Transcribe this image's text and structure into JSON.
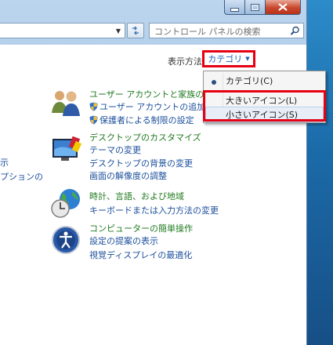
{
  "search": {
    "placeholder": "コントロール パネルの検索"
  },
  "view": {
    "label": "表示方法",
    "current": "カテゴリ"
  },
  "menu": {
    "items": [
      "カテゴリ(C)",
      "大きいアイコン(L)",
      "小さいアイコン(S)"
    ],
    "selected": "カテゴリ(C)"
  },
  "left_panel": {
    "fragments": [
      "示",
      "プションの"
    ]
  },
  "categories": [
    {
      "title": "ユーザー アカウントと家族のた",
      "links": [
        "ユーザー アカウントの追加ま",
        "保護者による制限の設定"
      ],
      "icon": "users-icon"
    },
    {
      "title": "デスクトップのカスタマイズ",
      "links": [
        "テーマの変更",
        "デスクトップの背景の変更",
        "画面の解像度の調整"
      ],
      "icon": "desktop-icon"
    },
    {
      "title": "時計、言語、および地域",
      "links": [
        "キーボードまたは入力方法の変更"
      ],
      "icon": "clock-globe-icon"
    },
    {
      "title": "コンピューターの簡単操作",
      "links": [
        "設定の提案の表示",
        "視覚ディスプレイの最適化"
      ],
      "icon": "ease-of-access-icon"
    }
  ],
  "colors": {
    "highlight_border": "#e60012",
    "link": "#1c4f9c",
    "category_title": "#1f7a1f"
  }
}
